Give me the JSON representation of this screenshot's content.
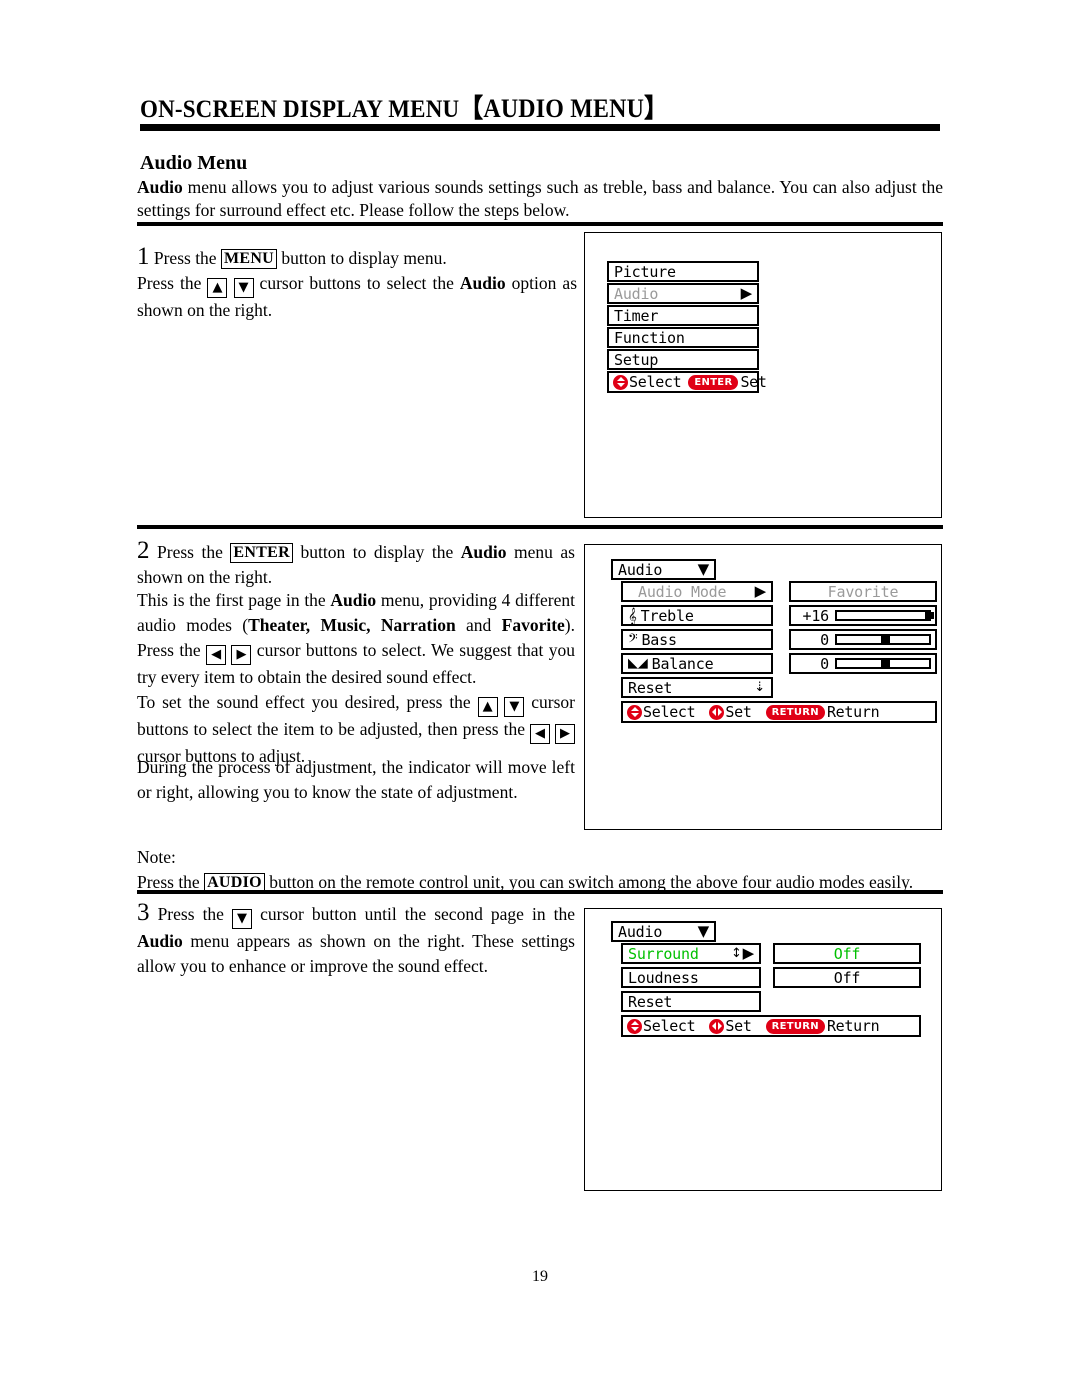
{
  "document": {
    "chapter_title": "ON-SCREEN DISPLAY MENU",
    "chapter_title_bracketed": "【AUDIO MENU】",
    "section_heading": "Audio Menu",
    "intro_bold": "Audio",
    "intro_rest": " menu allows you to adjust various sounds settings such as treble, bass and balance. You can also adjust the settings for surround effect etc. Please follow the steps below.",
    "page_number": "19"
  },
  "steps": {
    "step1": {
      "number": "1",
      "t1": "Press the ",
      "key_menu": "MENU",
      "t2": " button to display menu.",
      "t3": "Press the ",
      "arrow_up": "▲",
      "arrow_down": "▼",
      "t4": " cursor buttons to select the ",
      "bold_audio": "Audio",
      "t5": " option as shown on the right."
    },
    "step2": {
      "number": "2",
      "t1": "Press the ",
      "key_enter": "ENTER",
      "t2": " button to display the ",
      "bold_audio": "Audio",
      "t3": " menu as shown on the right.",
      "p2a": "This is the first page in the ",
      "p2b": "Audio",
      "p2c": " menu, providing 4 different audio modes (",
      "p2_modes": "Theater, Music, Narration",
      "p2d": " and ",
      "p2_fav": "Favorite",
      "p2e": "). Press the ",
      "arrow_left": "◀",
      "arrow_right": "▶",
      "p2f": " cursor buttons to select. We suggest that you try every item to obtain the desired sound effect.",
      "p3a": "To set the sound effect you desired, press the ",
      "arrow_up": "▲",
      "arrow_down": "▼",
      "p3b": " cursor buttons to select the item to be adjusted, then press the ",
      "p3c": " cursor buttons to adjust.",
      "p4": "During the process of adjustment, the indicator will move left or right, allowing you to know the state of adjustment."
    },
    "note": {
      "label": "Note:",
      "t1": "Press the ",
      "key_audio": "AUDIO",
      "t2": " button on the remote control unit, you can switch among the above four audio modes easily."
    },
    "step3": {
      "number": "3",
      "t1": "Press the ",
      "arrow_down": "▼",
      "t2": " cursor button until the second page in the ",
      "bold_audio": "Audio",
      "t3": " menu appears as shown on the right. These settings allow you to enhance or improve the sound effect."
    }
  },
  "osd_main_menu": {
    "items": [
      {
        "label": "Picture",
        "state": "normal",
        "arrow": ""
      },
      {
        "label": "Audio",
        "state": "dim",
        "arrow": "▶"
      },
      {
        "label": "Timer",
        "state": "normal",
        "arrow": ""
      },
      {
        "label": "Function",
        "state": "normal",
        "arrow": ""
      },
      {
        "label": "Setup",
        "state": "normal",
        "arrow": ""
      }
    ],
    "hint": {
      "select_label": "Select",
      "set_label": "Set",
      "enter_badge": "ENTER"
    }
  },
  "osd_audio_page1": {
    "header": "Audio",
    "header_arrow": "▼",
    "rows": [
      {
        "label": "Audio Mode",
        "icon": "",
        "arrow": "▶",
        "state": "dim",
        "value": "Favorite",
        "value_state": "dim",
        "value_type": "text"
      },
      {
        "label": "Treble",
        "icon": "𝄞",
        "arrow": "",
        "state": "normal",
        "value": "+16",
        "value_state": "normal",
        "value_type": "bar",
        "bar_percent": 100
      },
      {
        "label": "Bass",
        "icon": "𝄢",
        "arrow": "",
        "state": "normal",
        "value": "0",
        "value_state": "normal",
        "value_type": "bar",
        "bar_percent": 50
      },
      {
        "label": "Balance",
        "icon": "◣◢",
        "arrow": "",
        "state": "normal",
        "value": "0",
        "value_state": "normal",
        "value_type": "bar",
        "bar_percent": 50
      },
      {
        "label": "Reset",
        "icon": "",
        "arrow": "⇣",
        "state": "normal",
        "value": "",
        "value_state": "normal",
        "value_type": "none"
      }
    ],
    "hint": {
      "select_label": "Select",
      "set_label": "Set",
      "return_badge": "RETURN",
      "return_label": "Return"
    }
  },
  "osd_audio_page2": {
    "header": "Audio",
    "header_arrow": "▼",
    "rows": [
      {
        "label": "Surround",
        "arrow": "▶",
        "state": "green",
        "value": "Off",
        "value_state": "green"
      },
      {
        "label": "Loudness",
        "arrow": "",
        "state": "normal",
        "value": "Off",
        "value_state": "normal"
      },
      {
        "label": "Reset",
        "arrow": "",
        "state": "normal",
        "value": "",
        "value_state": "normal"
      }
    ],
    "hint": {
      "select_label": "Select",
      "set_label": "Set",
      "return_badge": "RETURN",
      "return_label": "Return"
    }
  }
}
